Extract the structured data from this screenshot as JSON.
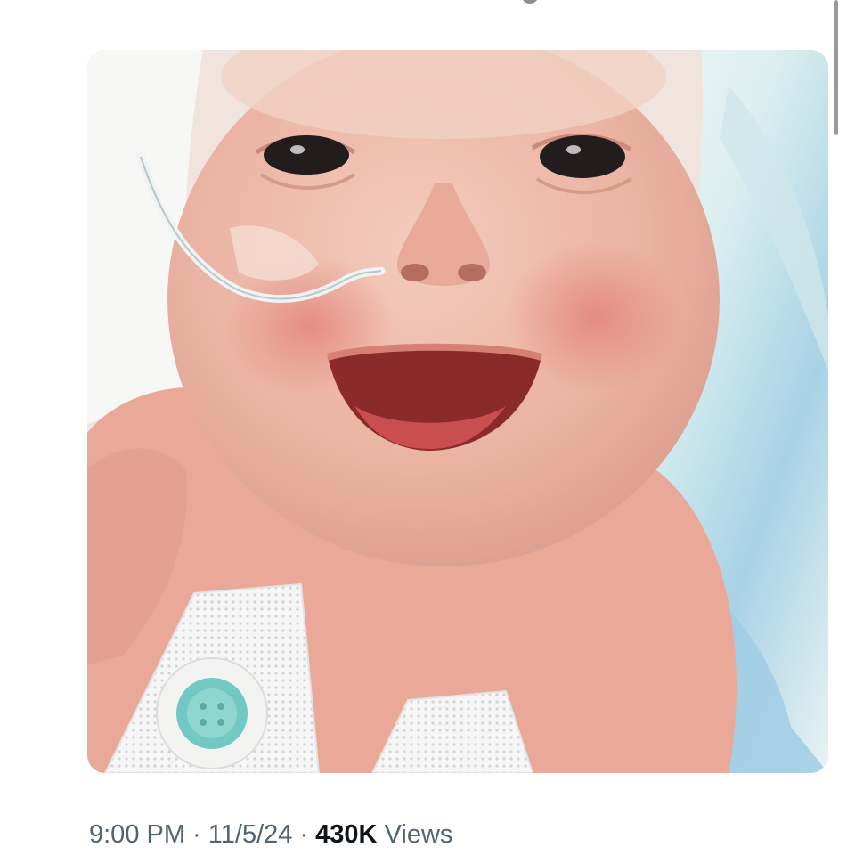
{
  "tweet": {
    "time": "9:00 PM",
    "separator": " · ",
    "date": "11/5/24",
    "views_count": "430K",
    "views_label": "Views"
  },
  "media": {
    "icon": "photo-icon"
  },
  "colors": {
    "meta_text": "#536471",
    "views_count": "#0f1419",
    "background": "#ffffff"
  }
}
